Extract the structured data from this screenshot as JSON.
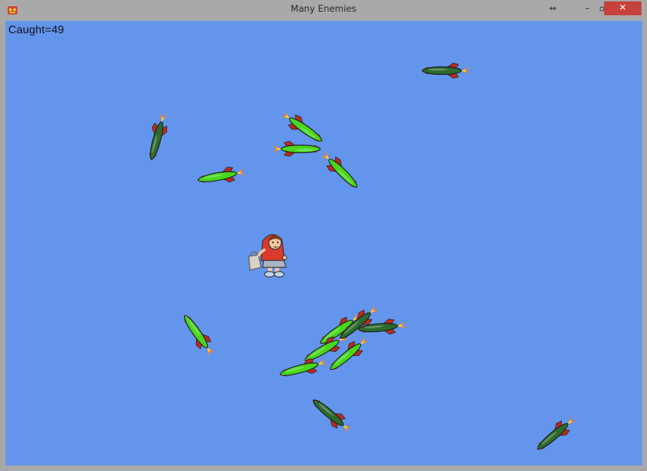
{
  "window": {
    "title": "Many Enemies",
    "icons": {
      "app": "game-app-icon",
      "pin": "double-arrow-icon",
      "minimize": "minimize-icon",
      "maximize": "maximize-icon",
      "close": "close-icon"
    },
    "minimize_label": "–",
    "maximize_label": "▫",
    "pin_label": "↔",
    "close_label": "✕"
  },
  "game": {
    "score_text": "Caught=49",
    "background_color": "#6495ed",
    "player": {
      "name": "red-riding-hood-player"
    },
    "enemies": [
      {
        "name": "rocket-1",
        "heading": 0,
        "color": "dark"
      },
      {
        "name": "rocket-2",
        "heading": -75,
        "color": "dark"
      },
      {
        "name": "rocket-3",
        "heading": -10,
        "color": "green"
      },
      {
        "name": "rocket-4",
        "heading": 215,
        "color": "green"
      },
      {
        "name": "rocket-5",
        "heading": 180,
        "color": "green"
      },
      {
        "name": "rocket-6",
        "heading": 225,
        "color": "green"
      },
      {
        "name": "rocket-7",
        "heading": -35,
        "color": "green"
      },
      {
        "name": "rocket-8",
        "heading": -30,
        "color": "green"
      },
      {
        "name": "rocket-9",
        "heading": -15,
        "color": "green"
      },
      {
        "name": "rocket-10",
        "heading": -40,
        "color": "green"
      },
      {
        "name": "rocket-11",
        "heading": -5,
        "color": "dark"
      },
      {
        "name": "rocket-12",
        "heading": -40,
        "color": "dark"
      },
      {
        "name": "rocket-13",
        "heading": 55,
        "color": "green"
      },
      {
        "name": "rocket-14",
        "heading": 40,
        "color": "dark"
      },
      {
        "name": "rocket-15",
        "heading": -40,
        "color": "dark"
      }
    ]
  }
}
